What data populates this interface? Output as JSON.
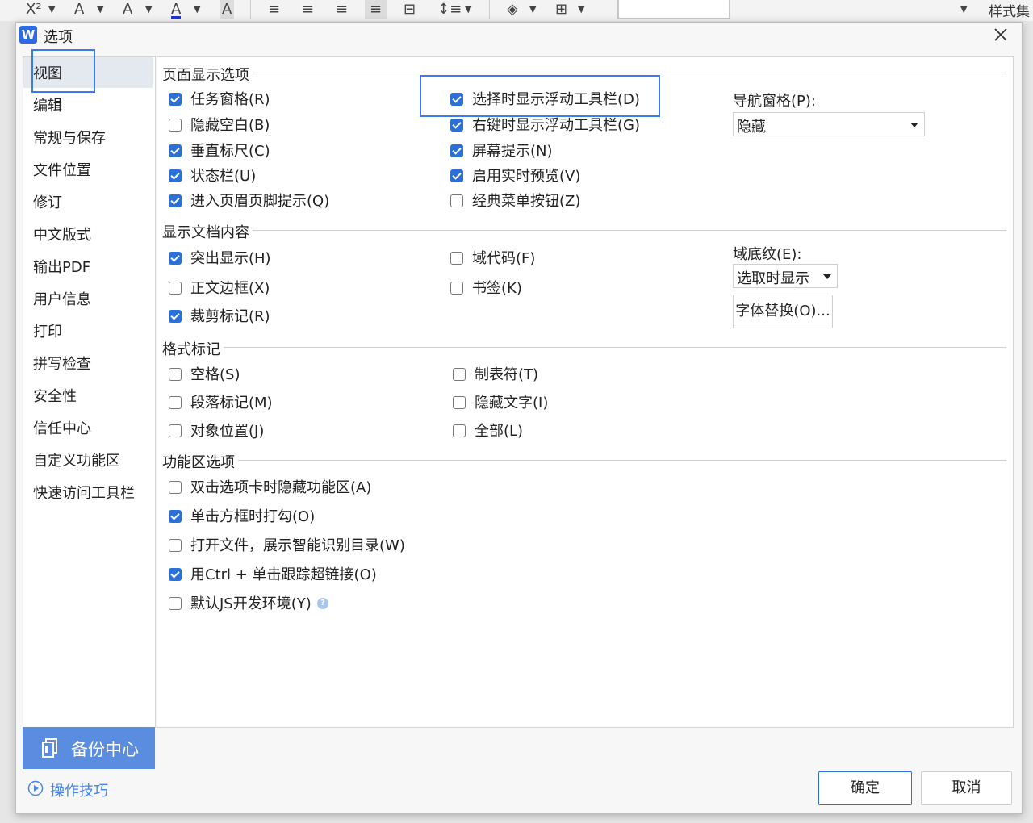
{
  "toolbar": {
    "superscript": "X²",
    "font_color": "A",
    "highlight": "A",
    "char_shading": "A",
    "right_label": "样式集"
  },
  "dialog": {
    "title": "选项",
    "app_icon": "W",
    "close_icon": "close-icon"
  },
  "sidebar": {
    "items": [
      {
        "label": "视图",
        "active": true
      },
      {
        "label": "编辑"
      },
      {
        "label": "常规与保存"
      },
      {
        "label": "文件位置"
      },
      {
        "label": "修订"
      },
      {
        "label": "中文版式"
      },
      {
        "label": "输出PDF"
      },
      {
        "label": "用户信息"
      },
      {
        "label": "打印"
      },
      {
        "label": "拼写检查"
      },
      {
        "label": "安全性"
      },
      {
        "label": "信任中心"
      },
      {
        "label": "自定义功能区"
      },
      {
        "label": "快速访问工具栏"
      }
    ],
    "backup_label": "备份中心",
    "tips_label": "操作技巧"
  },
  "page_display": {
    "title": "页面显示选项",
    "options": [
      {
        "label": "任务窗格(R)",
        "checked": true
      },
      {
        "label": "隐藏空白(B)",
        "checked": false
      },
      {
        "label": "垂直标尺(C)",
        "checked": true
      },
      {
        "label": "状态栏(U)",
        "checked": true
      },
      {
        "label": "进入页眉页脚提示(Q)",
        "checked": true
      },
      {
        "label": "选择时显示浮动工具栏(D)",
        "checked": true
      },
      {
        "label": "右键时显示浮动工具栏(G)",
        "checked": true
      },
      {
        "label": "屏幕提示(N)",
        "checked": true
      },
      {
        "label": "启用实时预览(V)",
        "checked": true
      },
      {
        "label": "经典菜单按钮(Z)",
        "checked": false
      }
    ],
    "nav_pane_label": "导航窗格(P):",
    "nav_pane_value": "隐藏"
  },
  "doc_content": {
    "title": "显示文档内容",
    "options": [
      {
        "label": "突出显示(H)",
        "checked": true
      },
      {
        "label": "正文边框(X)",
        "checked": false
      },
      {
        "label": "裁剪标记(R)",
        "checked": true
      },
      {
        "label": "域代码(F)",
        "checked": false
      },
      {
        "label": "书签(K)",
        "checked": false
      }
    ],
    "field_shading_label": "域底纹(E):",
    "field_shading_value": "选取时显示",
    "font_sub_button": "字体替换(O)..."
  },
  "format_marks": {
    "title": "格式标记",
    "options": [
      {
        "label": "空格(S)",
        "checked": false
      },
      {
        "label": "段落标记(M)",
        "checked": false
      },
      {
        "label": "对象位置(J)",
        "checked": false
      },
      {
        "label": "制表符(T)",
        "checked": false
      },
      {
        "label": "隐藏文字(I)",
        "checked": false
      },
      {
        "label": "全部(L)",
        "checked": false
      }
    ]
  },
  "ribbon": {
    "title": "功能区选项",
    "options": [
      {
        "label": "双击选项卡时隐藏功能区(A)",
        "checked": false
      },
      {
        "label": "单击方框时打勾(O)",
        "checked": true
      },
      {
        "label": "打开文件，展示智能识别目录(W)",
        "checked": false
      },
      {
        "label": "用Ctrl + 单击跟踪超链接(O)",
        "checked": true
      },
      {
        "label": "默认JS开发环境(Y)",
        "checked": false
      }
    ],
    "help_glyph": "?"
  },
  "footer": {
    "ok_label": "确定",
    "cancel_label": "取消"
  },
  "colors": {
    "accent": "#2c6fd8",
    "highlight_box": "#3b7bf2",
    "backup_bg": "#5a8cdf"
  }
}
